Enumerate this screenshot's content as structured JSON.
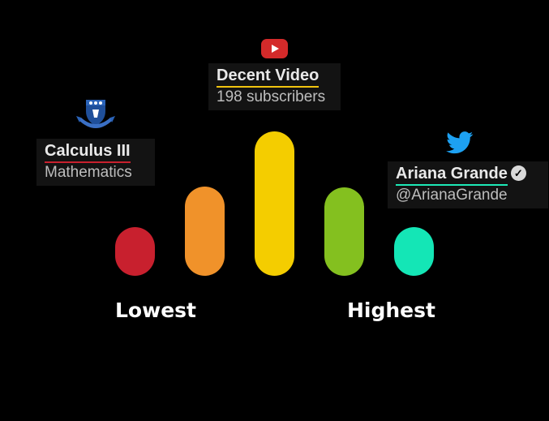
{
  "colors": {
    "background": "#000000",
    "bar_1": "#c8202e",
    "bar_2": "#f0922a",
    "bar_3": "#f4cd00",
    "bar_4": "#84c01f",
    "bar_5": "#14e6b6"
  },
  "scale": {
    "lowest_label": "Lowest",
    "highest_label": "Highest"
  },
  "cards": {
    "calculus": {
      "icon": "university-crest-icon",
      "title": "Calculus III",
      "subtitle": "Mathematics"
    },
    "youtube": {
      "icon": "youtube-icon",
      "title": "Decent Video",
      "subtitle": "198 subscribers"
    },
    "twitter": {
      "icon": "twitter-bird-icon",
      "title": "Ariana Grande",
      "subtitle": "@ArianaGrande",
      "verified_icon": "verified-badge-icon"
    }
  }
}
